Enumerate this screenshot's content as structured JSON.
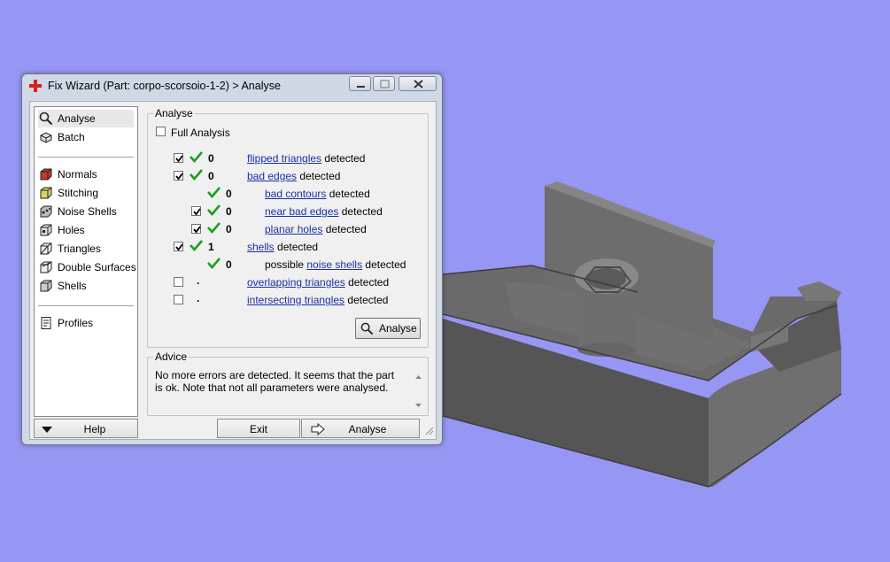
{
  "window": {
    "title": "Fix Wizard (Part: corpo-scorsoio-1-2) > Analyse",
    "controls": {
      "minimize": "minimize-icon",
      "maximize": "maximize-icon",
      "close": "close-icon"
    }
  },
  "sidebar": {
    "items": [
      {
        "label": "Analyse",
        "icon": "magnifier-icon",
        "selected": true
      },
      {
        "label": "Batch",
        "icon": "batch-icon"
      },
      {
        "label": "Normals",
        "icon": "normals-cube-icon"
      },
      {
        "label": "Stitching",
        "icon": "stitching-cube-icon"
      },
      {
        "label": "Noise Shells",
        "icon": "noise-shells-icon"
      },
      {
        "label": "Holes",
        "icon": "holes-cube-icon"
      },
      {
        "label": "Triangles",
        "icon": "triangles-cube-icon"
      },
      {
        "label": "Double Surfaces",
        "icon": "double-surfaces-icon"
      },
      {
        "label": "Shells",
        "icon": "shells-cube-icon"
      },
      {
        "label": "Profiles",
        "icon": "profiles-icon"
      }
    ]
  },
  "analyse": {
    "group_title": "Analyse",
    "full_analysis_label": "Full Analysis",
    "full_analysis_checked": false,
    "rows": [
      {
        "checked": true,
        "ok": true,
        "count": "0",
        "link": "flipped triangles",
        "suffix": " detected",
        "prefix": ""
      },
      {
        "checked": true,
        "ok": true,
        "count": "0",
        "link": "bad edges",
        "suffix": " detected",
        "prefix": ""
      },
      {
        "checked": null,
        "ok": true,
        "count": "0",
        "link": "bad contours",
        "suffix": " detected",
        "prefix": ""
      },
      {
        "checked": true,
        "ok": true,
        "count": "0",
        "link": "near bad edges",
        "suffix": " detected",
        "prefix": ""
      },
      {
        "checked": true,
        "ok": true,
        "count": "0",
        "link": "planar holes",
        "suffix": " detected",
        "prefix": ""
      },
      {
        "checked": true,
        "ok": true,
        "count": "1",
        "link": "shells",
        "suffix": " detected",
        "prefix": ""
      },
      {
        "checked": null,
        "ok": true,
        "count": "0",
        "link": "noise shells",
        "suffix": " detected",
        "prefix": "possible "
      },
      {
        "checked": false,
        "ok": false,
        "count": ".",
        "link": "overlapping triangles",
        "suffix": " detected",
        "prefix": ""
      },
      {
        "checked": false,
        "ok": false,
        "count": ".",
        "link": "intersecting triangles",
        "suffix": " detected",
        "prefix": ""
      }
    ],
    "analyse_button": "Analyse"
  },
  "advice": {
    "group_title": "Advice",
    "text": "No more errors are detected. It seems that the part is ok. Note that not all parameters were analysed."
  },
  "bottom": {
    "help": "Help",
    "exit": "Exit",
    "analyse": "Analyse"
  },
  "colors": {
    "background": "#9696f4",
    "link": "#1a2fa6",
    "check_green": "#1aa01a",
    "model_gray": "#5e5e5e"
  }
}
